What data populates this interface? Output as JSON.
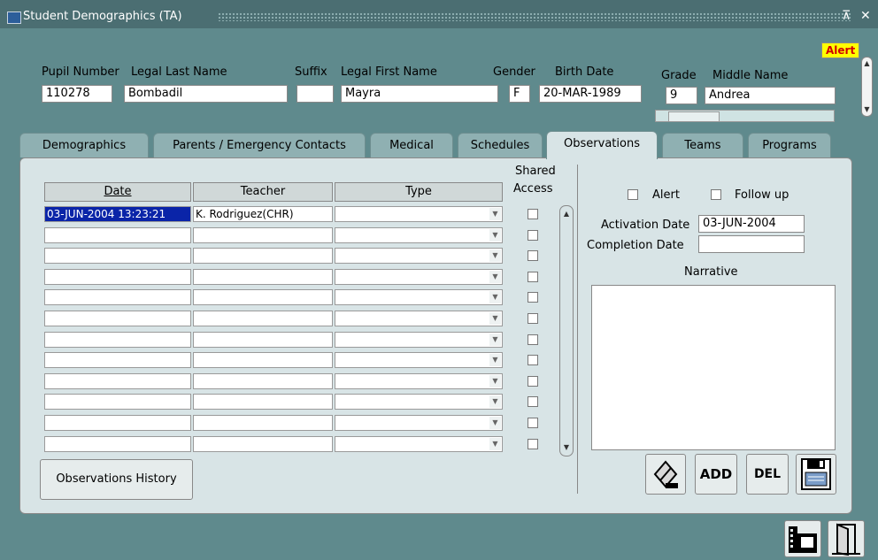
{
  "window": {
    "title": "Student Demographics (TA)",
    "minimize_glyph": "⊼",
    "close_glyph": "✕"
  },
  "alert_badge": "Alert",
  "header": {
    "labels": {
      "pupil_number": "Pupil Number",
      "legal_last_name": "Legal Last Name",
      "suffix": "Suffix",
      "legal_first_name": "Legal First Name",
      "gender": "Gender",
      "birth_date": "Birth Date",
      "grade": "Grade",
      "middle_name": "Middle Name"
    },
    "values": {
      "pupil_number": "110278",
      "legal_last_name": "Bombadil",
      "suffix": "",
      "legal_first_name": "Mayra",
      "gender": "F",
      "birth_date": "20-MAR-1989",
      "grade": "9",
      "middle_name": "Andrea"
    }
  },
  "tabs": [
    "Demographics",
    "Parents / Emergency Contacts",
    "Medical",
    "Schedules",
    "Observations",
    "Teams",
    "Programs"
  ],
  "active_tab": "Observations",
  "grid": {
    "headers": {
      "date": "Date",
      "teacher": "Teacher",
      "type": "Type",
      "shared_access_1": "Shared",
      "shared_access_2": "Access"
    },
    "first_row": {
      "date": "03-JUN-2004 13:23:21",
      "teacher": "K. Rodriguez(CHR)",
      "type": ""
    }
  },
  "details": {
    "alert_label": "Alert",
    "follow_up_label": "Follow up",
    "activation_date_label": "Activation Date",
    "activation_date_value": "03-JUN-2004",
    "completion_date_label": "Completion Date",
    "completion_date_value": "",
    "narrative_label": "Narrative",
    "narrative_value": ""
  },
  "buttons": {
    "history": "Observations History",
    "add": "ADD",
    "del": "DEL"
  },
  "icons": {
    "eraser": "eraser-icon",
    "save": "save-icon",
    "film": "film-icon",
    "exit": "exit-door-icon"
  }
}
